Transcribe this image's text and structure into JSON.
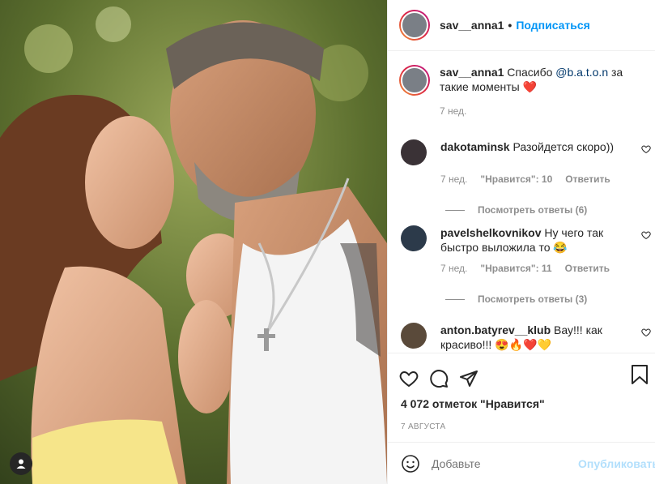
{
  "post": {
    "author": "sav__anna1",
    "follow_label": "Подписаться",
    "separator": "•"
  },
  "caption": {
    "author": "sav__anna1",
    "text_before": "Спасибо ",
    "mention": "@b.a.t.o.n",
    "text_after": " за такие моменты ❤️",
    "age": "7 нед."
  },
  "comments": [
    {
      "author": "dakotaminsk",
      "text": "Разойдется скоро))",
      "age": "7 нед.",
      "likes": "\"Нравится\": 10",
      "reply_label": "Ответить",
      "view_replies": "Посмотреть ответы (6)"
    },
    {
      "author": "pavelshelkovnikov",
      "text": "Ну чего так быстро выложила то 😂",
      "age": "7 нед.",
      "likes": "\"Нравится\": 11",
      "reply_label": "Ответить",
      "view_replies": "Посмотреть ответы (3)"
    },
    {
      "author": "anton.batyrev__klub",
      "text": "Вау!!! как красиво!!! 😍🔥❤️💛"
    }
  ],
  "stats": {
    "likes_text": "4 072 отметок \"Нравится\"",
    "date": "7 АВГУСТА"
  },
  "composer": {
    "placeholder": "Добавьте",
    "publish_label": "Опубликовать"
  },
  "icons": {
    "like": "heart-icon",
    "comment": "comment-icon",
    "share": "share-icon",
    "save": "bookmark-icon",
    "emoji": "emoji-icon",
    "tag": "user-tag-icon"
  },
  "colors": {
    "accent": "#0095f6",
    "publish_disabled": "#b2dffc",
    "muted": "#8e8e8e",
    "text": "#262626"
  }
}
